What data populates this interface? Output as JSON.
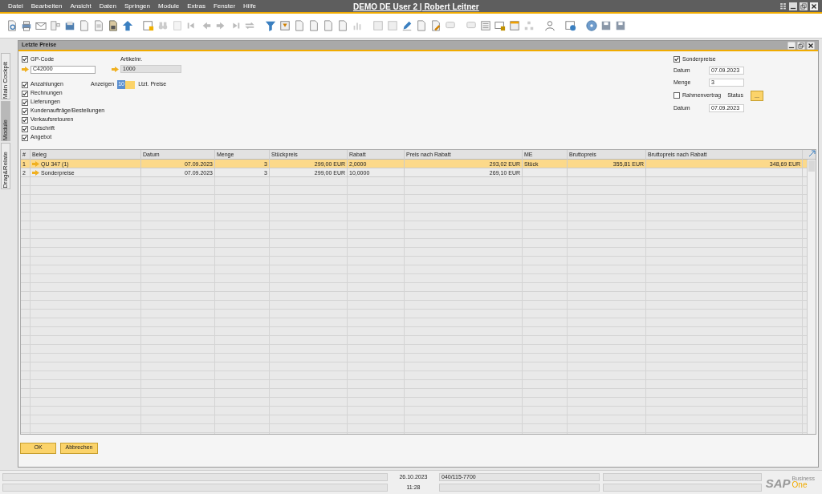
{
  "app": {
    "menus": [
      "Datei",
      "Bearbeiten",
      "Ansicht",
      "Daten",
      "Springen",
      "Module",
      "Extras",
      "Fenster",
      "Hilfe"
    ],
    "title": "DEMO DE User 2 | Robert Leitner"
  },
  "side_tabs": [
    {
      "label": "Main Cockpit",
      "selected": false
    },
    {
      "label": "Module",
      "selected": true
    },
    {
      "label": "Drag&Relate",
      "selected": false
    }
  ],
  "form": {
    "title": "Letzte Preise",
    "gp_code": {
      "label": "GP-Code",
      "checked": true,
      "value": "C42000"
    },
    "artikel": {
      "label": "Artikelnr.",
      "value": "1000"
    },
    "filters": [
      {
        "label": "Anzahlungen",
        "checked": true
      },
      {
        "label": "Rechnungen",
        "checked": true
      },
      {
        "label": "Lieferungen",
        "checked": true
      },
      {
        "label": "Kundenaufträge/Bestellungen",
        "checked": true
      },
      {
        "label": "Verkaufsretouren",
        "checked": true
      },
      {
        "label": "Gutschrift",
        "checked": true
      },
      {
        "label": "Angebot",
        "checked": true
      }
    ],
    "anzeigen": {
      "label": "Anzeigen",
      "value": "10",
      "suffix": "Ltzt. Preise"
    },
    "sonderpreise": {
      "label": "Sonderpreise",
      "checked": true,
      "datum_label": "Datum",
      "datum": "07.09.2023",
      "menge_label": "Menge",
      "menge": "3"
    },
    "rahmenvertrag": {
      "label": "Rahmenvertrag",
      "checked": false,
      "status_label": "Status",
      "status_button": "...",
      "datum_label": "Datum",
      "datum": "07.09.2023"
    },
    "table": {
      "columns": [
        "#",
        "Beleg",
        "Datum",
        "Menge",
        "Stückpreis",
        "Rabatt",
        "Preis nach Rabatt",
        "ME",
        "Bruttopreis",
        "Bruttopreis nach Rabatt"
      ],
      "rows": [
        {
          "selected": true,
          "cells": [
            "1",
            "QU 347 (1)",
            "07.09.2023",
            "3",
            "299,00 EUR",
            "2,0000",
            "293,02 EUR",
            "Stück",
            "355,81 EUR",
            "348,69 EUR"
          ]
        },
        {
          "selected": false,
          "cells": [
            "2",
            "Sonderpreise",
            "07.09.2023",
            "3",
            "299,00 EUR",
            "10,0000",
            "269,10 EUR",
            "",
            "",
            ""
          ]
        }
      ]
    },
    "buttons": [
      "OK",
      "Abbrechen"
    ]
  },
  "status_bar": {
    "date": "26.10.2023",
    "time": "11:28",
    "phone": "040/115-7700",
    "logo": "SAP",
    "logo_sub": "Business",
    "logo_one": "One"
  }
}
